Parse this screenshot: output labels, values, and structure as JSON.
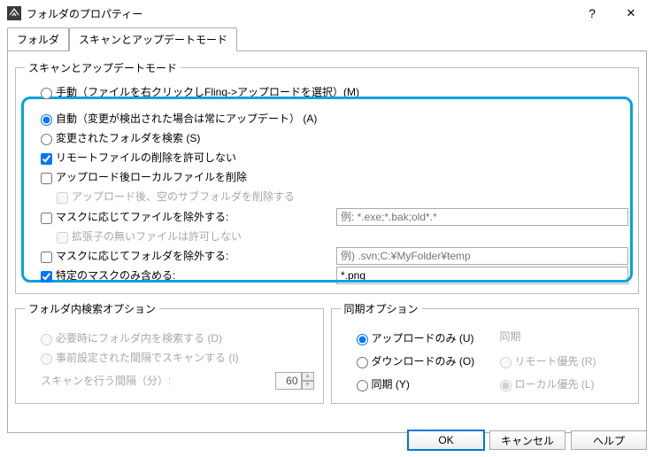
{
  "window": {
    "title": "フォルダのプロパティー",
    "help_icon": "?",
    "close_icon": "✕"
  },
  "tabs": {
    "folder": "フォルダ",
    "scan_update": "スキャンとアップデートモード"
  },
  "scan_mode": {
    "legend": "スキャンとアップデートモード",
    "manual": "手動（ファイルを右クリックしFling->アップロードを選択）(M)",
    "auto": "自動（変更が検出された場合は常にアップデート） (A)",
    "search_changed": "変更されたフォルダを検索 (S)",
    "disallow_remote_delete": "リモートファイルの削除を許可しない",
    "delete_local_after_upload": "アップロード後ローカルファイルを削除",
    "delete_empty_subfolder": "アップロード後、空のサブフォルダを削除する",
    "exclude_file_by_mask": "マスクに応じてファイルを除外する:",
    "exclude_file_example": "例: *.exe;*.bak;old*.*",
    "disallow_no_ext": "拡張子の無いファイルは許可しない",
    "exclude_folder_by_mask": "マスクに応じてフォルダを除外する:",
    "exclude_folder_example": "例) .svn;C:¥MyFolder¥temp",
    "include_only_mask": "特定のマスクのみ含める:",
    "include_value": "*.png"
  },
  "folder_search": {
    "legend": "フォルダ内検索オプション",
    "when_needed": "必要時にフォルダ内を検索する (D)",
    "preset_interval": "事前設定された間隔でスキャンする (I)",
    "scan_interval_label": "スキャンを行う間隔（分）:",
    "scan_interval_value": "60"
  },
  "sync_opts": {
    "legend": "同期オプション",
    "upload_only": "アップロードのみ (U)",
    "download_only": "ダウンロードのみ (O)",
    "sync": "同期 (Y)",
    "sync_header": "同期",
    "remote_priority": "リモート優先 (R)",
    "local_priority": "ローカル優先 (L)"
  },
  "buttons": {
    "ok": "OK",
    "cancel": "キャンセル",
    "help": "ヘルプ"
  }
}
